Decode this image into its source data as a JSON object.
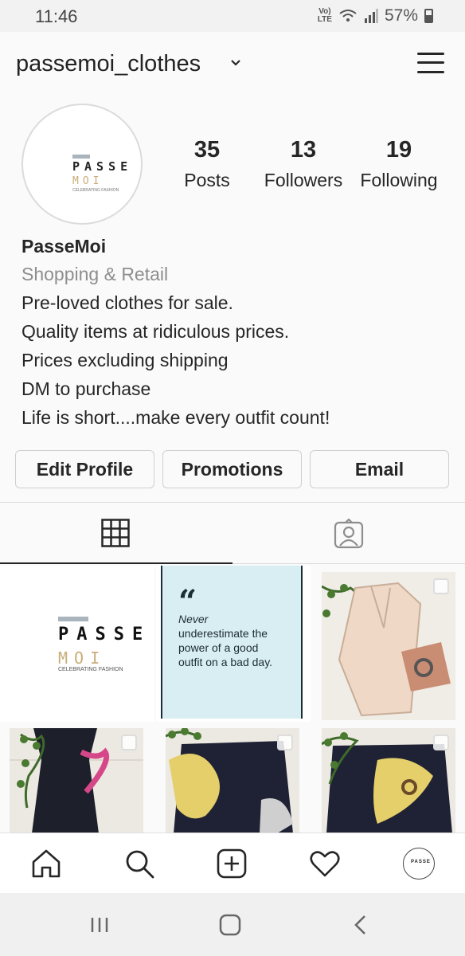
{
  "status": {
    "time": "11:46",
    "volte_top": "Vo)",
    "volte_bottom": "LTE",
    "battery": "57%"
  },
  "header": {
    "username": "passemoi_clothes"
  },
  "profile": {
    "avatar_logo": {
      "line1": "PASSE",
      "line2": "MOI",
      "tagline": "CELEBRATING FASHION"
    },
    "stats": [
      {
        "count": "35",
        "label": "Posts"
      },
      {
        "count": "13",
        "label": "Followers"
      },
      {
        "count": "19",
        "label": "Following"
      }
    ],
    "name": "PasseMoi",
    "category": "Shopping & Retail",
    "bio_lines": [
      "Pre-loved clothes for sale.",
      "Quality items at ridiculous prices.",
      "Prices excluding shipping",
      "DM to purchase",
      "Life is short....make every outfit count!"
    ]
  },
  "buttons": {
    "edit_profile": "Edit Profile",
    "promotions": "Promotions",
    "email": "Email"
  },
  "tabs": {
    "active": "grid-icon",
    "inactive": "tagged-icon"
  },
  "posts": {
    "logo_post": {
      "line1": "PASSE",
      "line2": "MOI",
      "tagline": "CELEBRATING FASHION"
    },
    "quote_post": {
      "mark": "“",
      "line1": "Never",
      "rest": "underestimate the power of a good outfit on a bad day."
    }
  },
  "bottom_nav": {
    "avatar_text": "PASSE"
  },
  "colors": {
    "accent_text": "#262626",
    "muted": "#8e8e8e",
    "quote_bg": "#d9eef2",
    "logo_gold": "#c9ad7a"
  }
}
